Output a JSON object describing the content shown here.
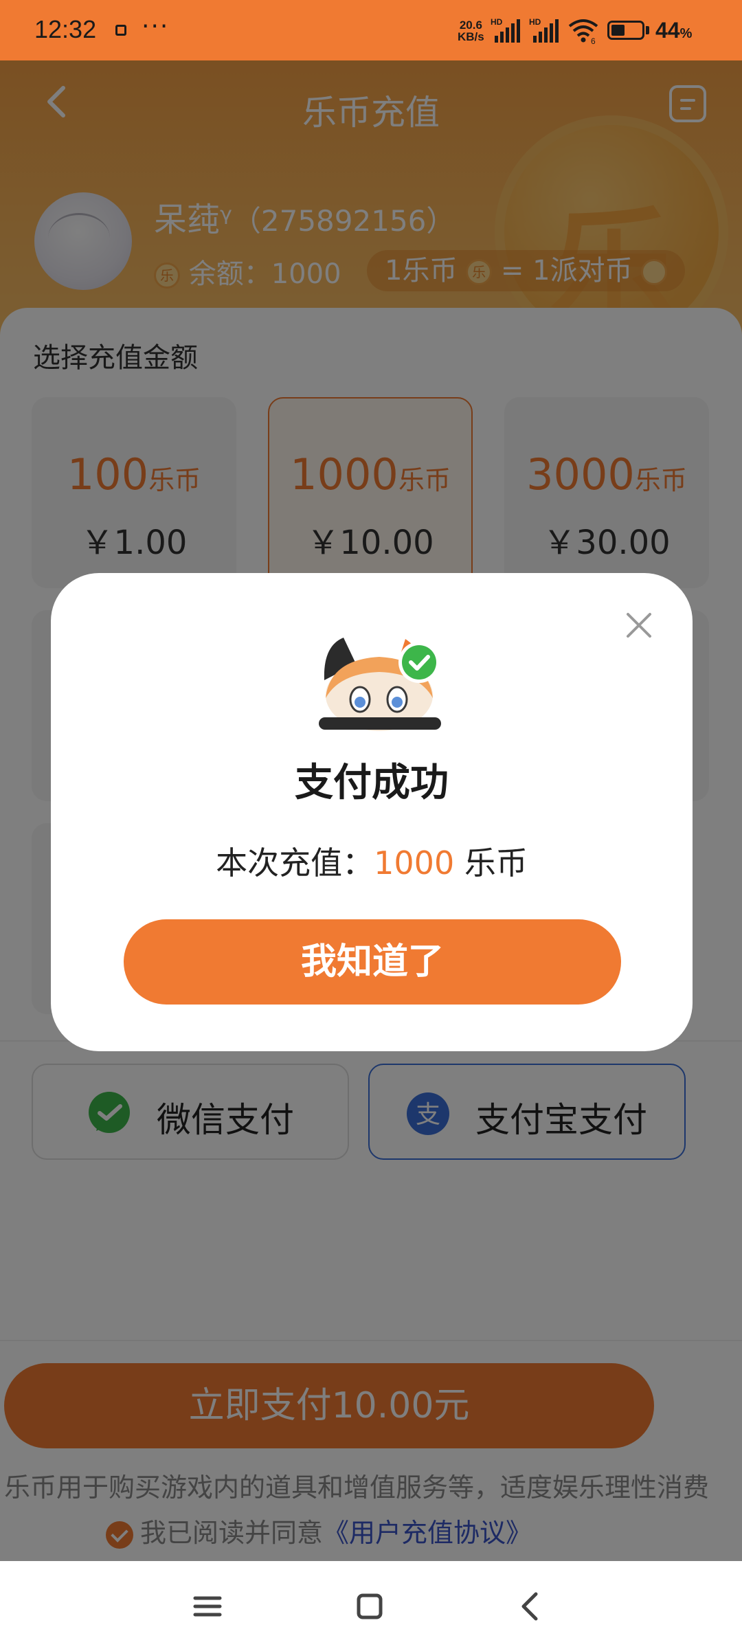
{
  "status_bar": {
    "time": "12:32",
    "dots": "···",
    "speed_value": "20.6",
    "speed_unit": "KB/s",
    "battery_value": "44",
    "battery_unit": "%",
    "battery_level": 0.44
  },
  "header": {
    "title": "乐币充值",
    "coin_glyph": "乐",
    "username": "呆莼ᵞ",
    "user_id": "（275892156）",
    "balance_label": "余额：",
    "balance_value": "1000",
    "rate_left": "1乐币",
    "rate_right": "= 1派对币"
  },
  "recharge": {
    "section_title": "选择充值金额",
    "packages": [
      {
        "amount": "100",
        "unit": "乐币",
        "price": "￥1.00"
      },
      {
        "amount": "1000",
        "unit": "乐币",
        "price": "￥10.00"
      },
      {
        "amount": "3000",
        "unit": "乐币",
        "price": "￥30.00"
      }
    ],
    "selected_index": 1
  },
  "payment": {
    "wechat_label": "微信支付",
    "alipay_label": "支付宝支付",
    "alipay_glyph": "支",
    "pay_button": "立即支付10.00元",
    "notice": "乐币用于购买游戏内的道具和增值服务等，适度娱乐理性消费",
    "agree_text": "我已阅读并同意",
    "agree_link": "《用户充值协议》"
  },
  "modal": {
    "title": "支付成功",
    "desc_prefix": "本次充值：",
    "desc_amount": "1000",
    "desc_unit": " 乐币",
    "ok_button": "我知道了"
  },
  "colors": {
    "accent": "#f07a32",
    "alipay_blue": "#3a6fd8",
    "wechat_green": "#3db64a",
    "link_blue": "#3a55c8"
  }
}
